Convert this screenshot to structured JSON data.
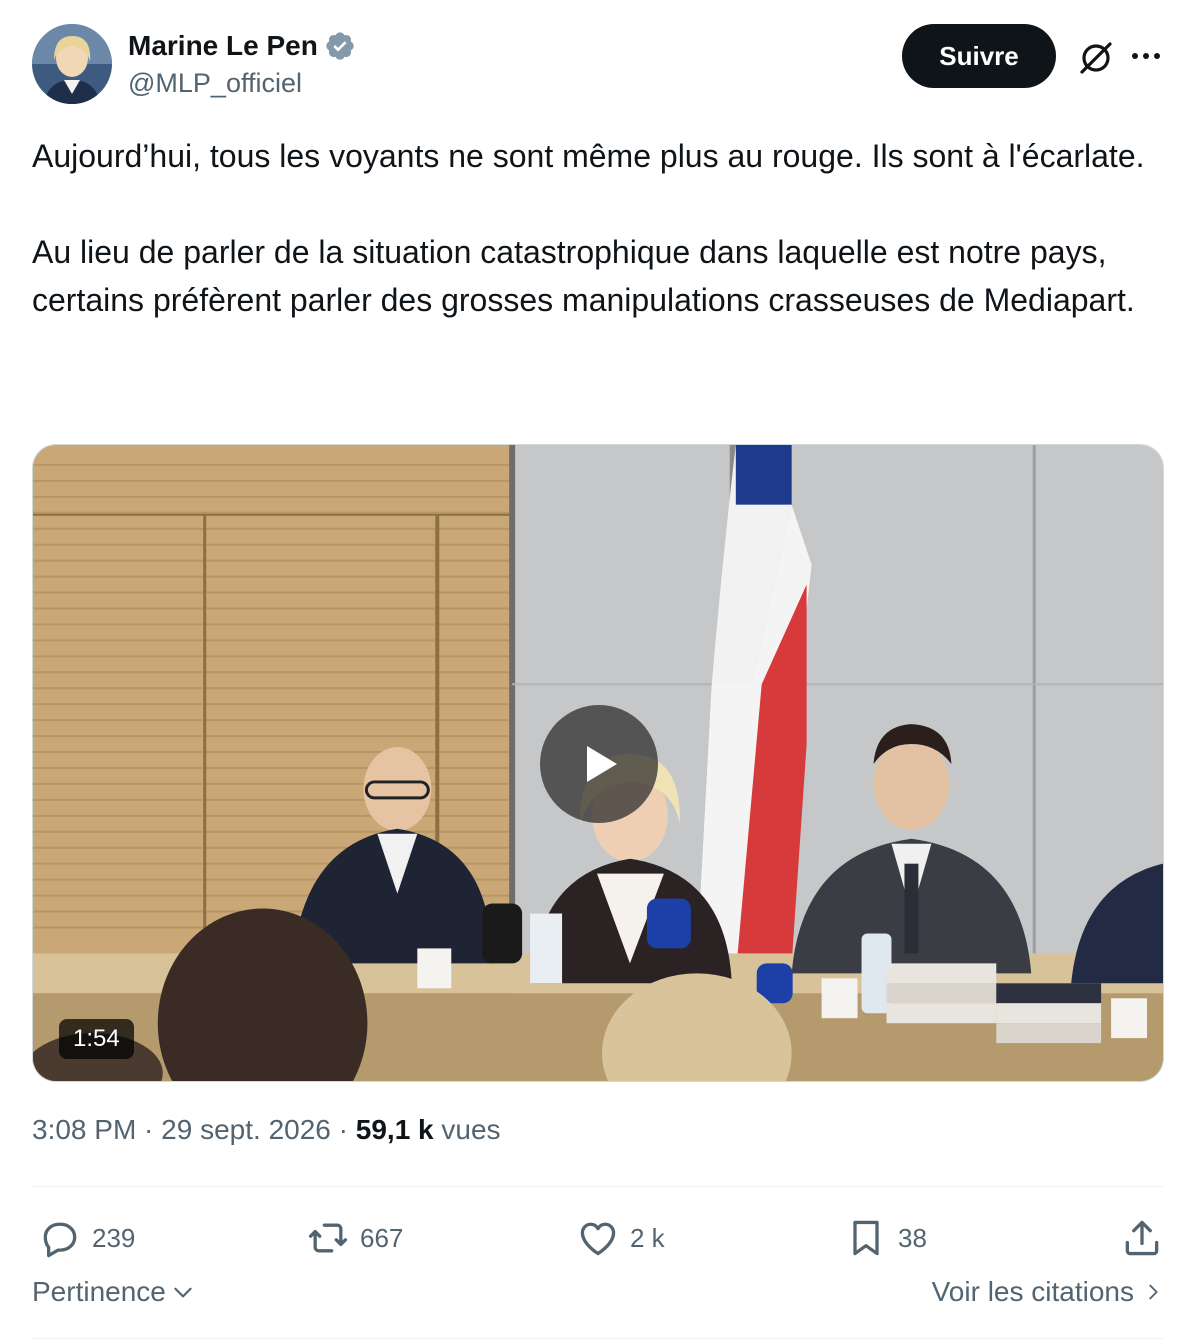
{
  "author": {
    "display_name": "Marine Le Pen",
    "handle": "@MLP_officiel",
    "verified": true,
    "avatar_icon": "avatar"
  },
  "header": {
    "follow_label": "Suivre",
    "grok_icon": "grok-icon",
    "more_icon": "more-icon"
  },
  "tweet": {
    "paragraphs": [
      "Aujourd’hui, tous les voyants ne sont même plus au rouge. Ils sont à l'écarlate.",
      "Au lieu de parler de la situation catastrophique dans laquelle est notre pays, certains préfèrent parler des grosses manipulations crasseuses de Mediapart."
    ]
  },
  "media": {
    "type": "video",
    "duration": "1:54",
    "play_icon": "play-icon"
  },
  "meta": {
    "time": "3:08 PM",
    "separator": " · ",
    "date": "29 sept. 2026",
    "views_count": "59,1 k",
    "views_label": "vues"
  },
  "actions": {
    "replies": "239",
    "reposts": "667",
    "likes": "2 k",
    "bookmarks": "38"
  },
  "footer": {
    "sort_label": "Pertinence",
    "quotes_label": "Voir les citations"
  },
  "colors": {
    "text": "#0f1419",
    "secondary": "#536471",
    "verified": "#829aab",
    "button_bg": "#0f1419",
    "divider": "#eff3f4"
  }
}
